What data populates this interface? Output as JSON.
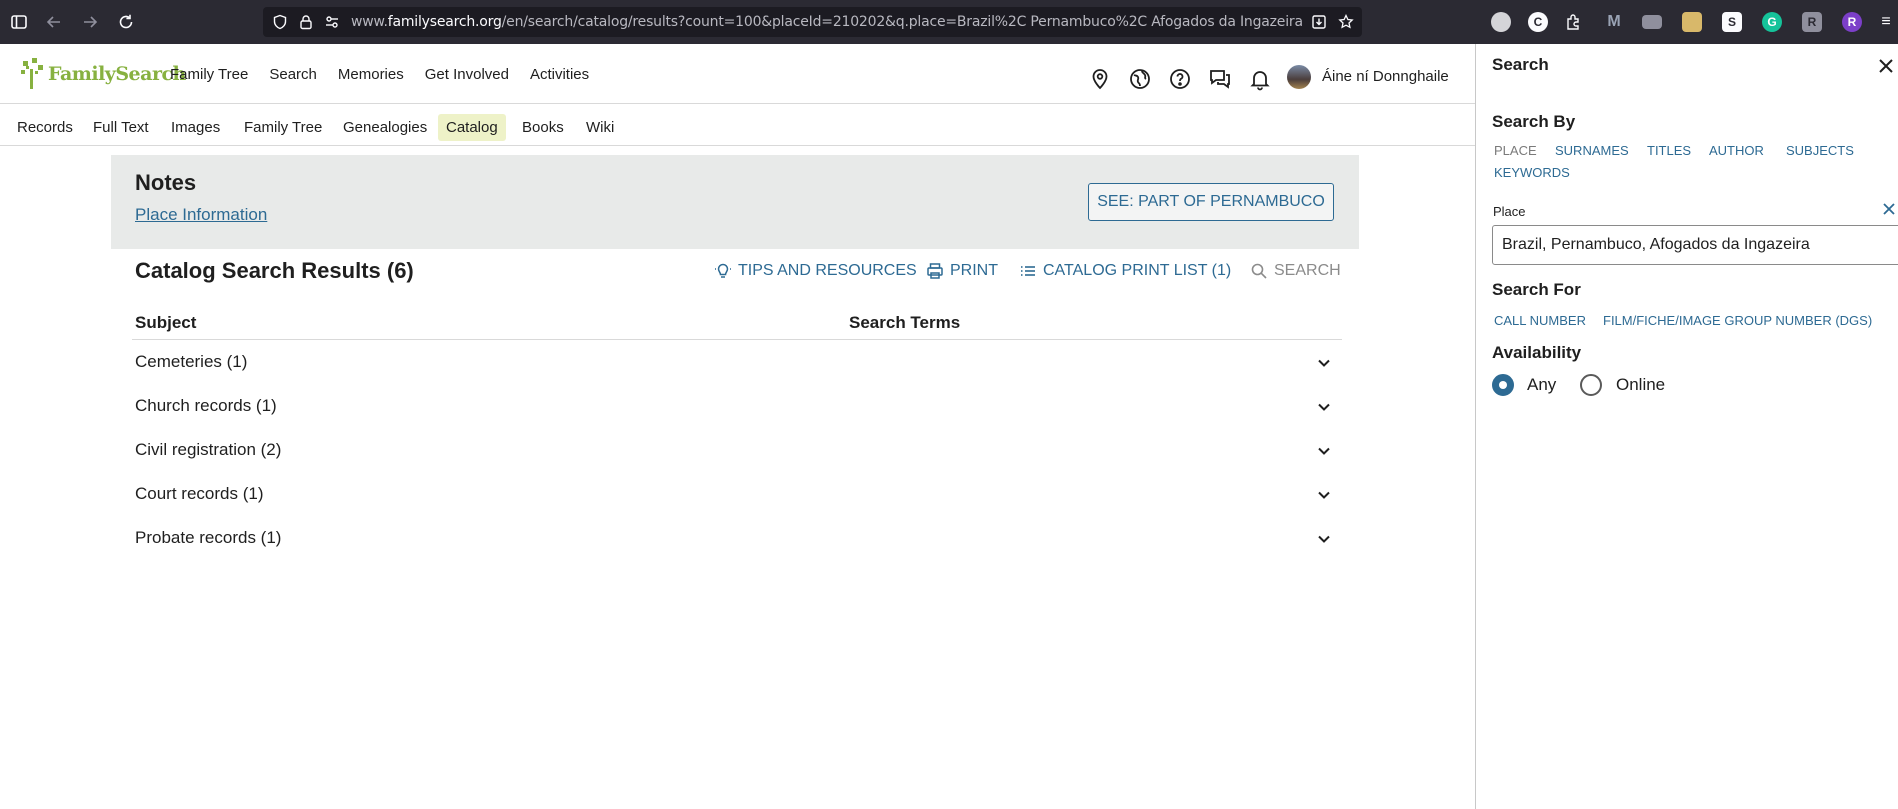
{
  "browser": {
    "url_prefix": "www.",
    "url_host": "familysearch.org",
    "url_path": "/en/search/catalog/results?count=100&placeId=210202&q.place=Brazil%2C Pernambuco%2C Afogados da Ingazeira"
  },
  "header": {
    "logo_text": "FamilySearch",
    "nav": [
      "Family Tree",
      "Search",
      "Memories",
      "Get Involved",
      "Activities"
    ],
    "user_name": "Áine ní Donnghaile"
  },
  "subnav": {
    "items": [
      "Records",
      "Full Text",
      "Images",
      "Family Tree",
      "Genealogies",
      "Catalog",
      "Books",
      "Wiki"
    ],
    "active": "Catalog"
  },
  "notes": {
    "title": "Notes",
    "place_info_link": "Place Information",
    "see_button": "SEE: PART OF PERNAMBUCO"
  },
  "results": {
    "title": "Catalog Search Results (6)",
    "actions": {
      "tips": "TIPS AND RESOURCES",
      "print": "PRINT",
      "print_list": "CATALOG PRINT LIST (1)",
      "search": "SEARCH"
    },
    "columns": {
      "subject": "Subject",
      "terms": "Search Terms"
    },
    "rows": [
      "Cemeteries (1)",
      "Church records (1)",
      "Civil registration (2)",
      "Court records (1)",
      "Probate records (1)"
    ]
  },
  "panel": {
    "title": "Search",
    "search_by": {
      "heading": "Search By",
      "tabs": [
        "PLACE",
        "SURNAMES",
        "TITLES",
        "AUTHOR",
        "SUBJECTS",
        "KEYWORDS"
      ],
      "current": "PLACE"
    },
    "place_field": {
      "label": "Place",
      "value": "Brazil, Pernambuco, Afogados da Ingazeira"
    },
    "search_for": {
      "heading": "Search For",
      "links": [
        "CALL NUMBER",
        "FILM/FICHE/IMAGE GROUP NUMBER (DGS)"
      ]
    },
    "availability": {
      "heading": "Availability",
      "options": [
        "Any",
        "Online"
      ],
      "selected": "Any"
    }
  },
  "colors": {
    "link": "#2d6a93",
    "logo_green": "#87b140",
    "active_tab_bg": "#eef2c8",
    "notes_bg": "#e8eae9",
    "browser_bg": "#2b2a33"
  }
}
